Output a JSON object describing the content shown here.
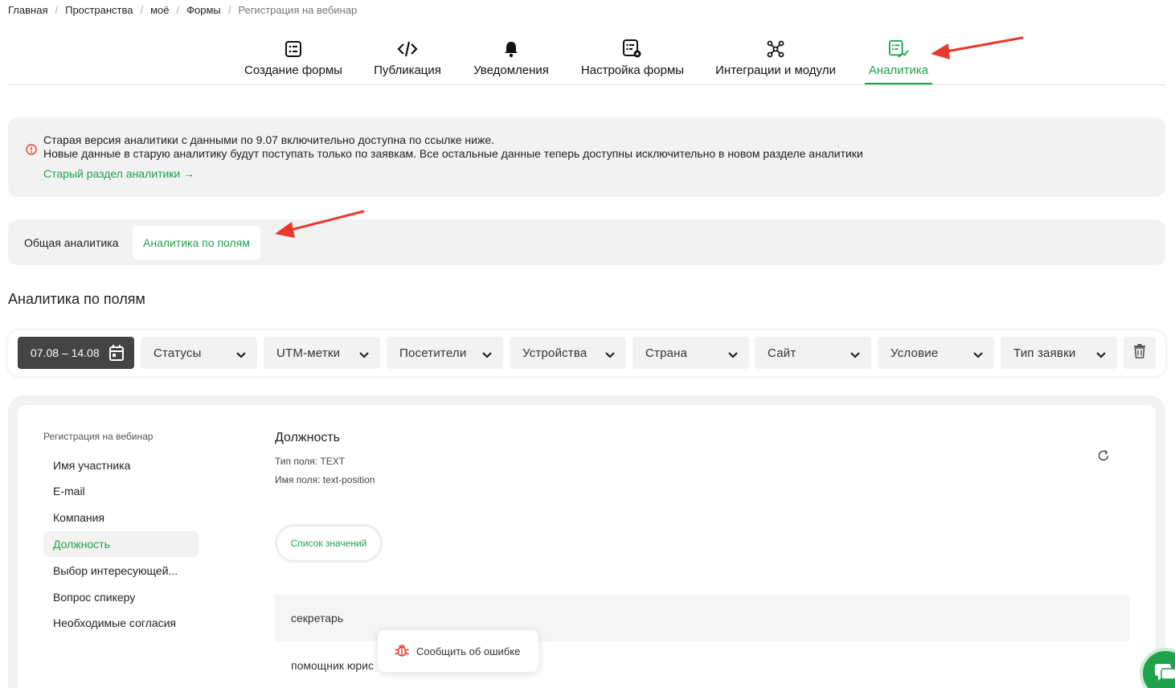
{
  "breadcrumb": [
    "Главная",
    "Пространства",
    "моё",
    "Формы",
    "Регистрация на вебинар"
  ],
  "tabs": [
    {
      "label": "Создание формы",
      "icon": "form-list-icon"
    },
    {
      "label": "Публикация",
      "icon": "code-icon"
    },
    {
      "label": "Уведомления",
      "icon": "bell-icon"
    },
    {
      "label": "Настройка формы",
      "icon": "form-settings-icon"
    },
    {
      "label": "Интеграции и модули",
      "icon": "integrations-icon"
    },
    {
      "label": "Аналитика",
      "icon": "analytics-icon",
      "active": true
    }
  ],
  "notice": {
    "line1": "Старая версия аналитики с данными по 9.07 включительно доступна по ссылке ниже.",
    "line2": "Новые данные в старую аналитику будут поступать только по заявкам. Все остальные данные теперь доступны исключительно в новом разделе аналитики",
    "link": "Старый раздел аналитики →"
  },
  "subtabs": {
    "general": "Общая аналитика",
    "fields": "Аналитика по полям"
  },
  "section_title": "Аналитика по полям",
  "filters": {
    "date_range": "07.08 – 14.08",
    "selects": [
      "Статусы",
      "UTM-метки",
      "Посетители",
      "Устройства",
      "Страна",
      "Сайт",
      "Условие",
      "Тип заявки"
    ]
  },
  "sidebar": {
    "form_name": "Регистрация на вебинар",
    "fields": [
      "Имя участника",
      "E-mail",
      "Компания",
      "Должность",
      "Выбор интересующей...",
      "Вопрос спикеру",
      "Необходимые согласия"
    ],
    "active_index": 3
  },
  "field_detail": {
    "title": "Должность",
    "type_line": "Тип поля: TEXT",
    "name_line": "Имя поля: text-position",
    "list_button": "Список значений",
    "values": [
      "секретарь",
      "помощник юрис"
    ]
  },
  "report_popup": "Сообщить об ошибке",
  "colors": {
    "accent": "#1fa24a",
    "arrow": "#e8392c",
    "date_button": "#444444"
  }
}
